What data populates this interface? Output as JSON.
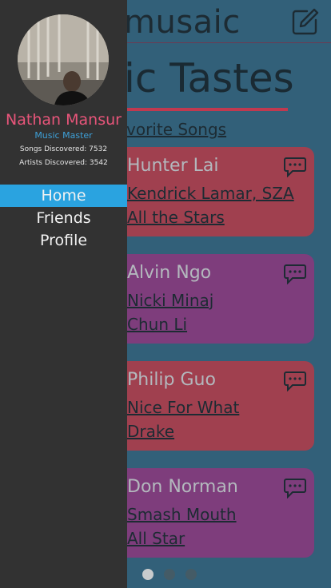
{
  "header": {
    "app_name": "musaic",
    "edit_icon": "edit-icon"
  },
  "page": {
    "title": "ic Tastes",
    "section_label": "vorite Songs"
  },
  "cards": [
    {
      "user": "Hunter Lai",
      "artist": "Kendrick Lamar, SZA",
      "song": "All the Stars",
      "color": "#a0404f"
    },
    {
      "user": "Alvin Ngo",
      "artist": "Nicki Minaj",
      "song": "Chun Li",
      "color": "#7e3d7c"
    },
    {
      "user": "Philip Guo",
      "artist": "Nice For What",
      "song": "Drake",
      "color": "#a0404f"
    },
    {
      "user": "Don Norman",
      "artist": "Smash Mouth",
      "song": "All Star",
      "color": "#7e3d7c"
    }
  ],
  "pagination": {
    "total": 3,
    "current": 1
  },
  "sidebar": {
    "profile": {
      "name": "Nathan Mansur",
      "rank": "Music Master",
      "songs_discovered": "Songs Discovered: 7532",
      "artists_discovered": "Artists Discovered: 3542"
    },
    "nav": [
      {
        "label": "Home",
        "active": true
      },
      {
        "label": "Friends",
        "active": false
      },
      {
        "label": "Profile",
        "active": false
      }
    ]
  },
  "colors": {
    "accent_blue": "#2aa3e0",
    "name_pink": "#e8557a",
    "card_red": "#a0404f",
    "card_purple": "#7e3d7c",
    "background": "#326079"
  }
}
